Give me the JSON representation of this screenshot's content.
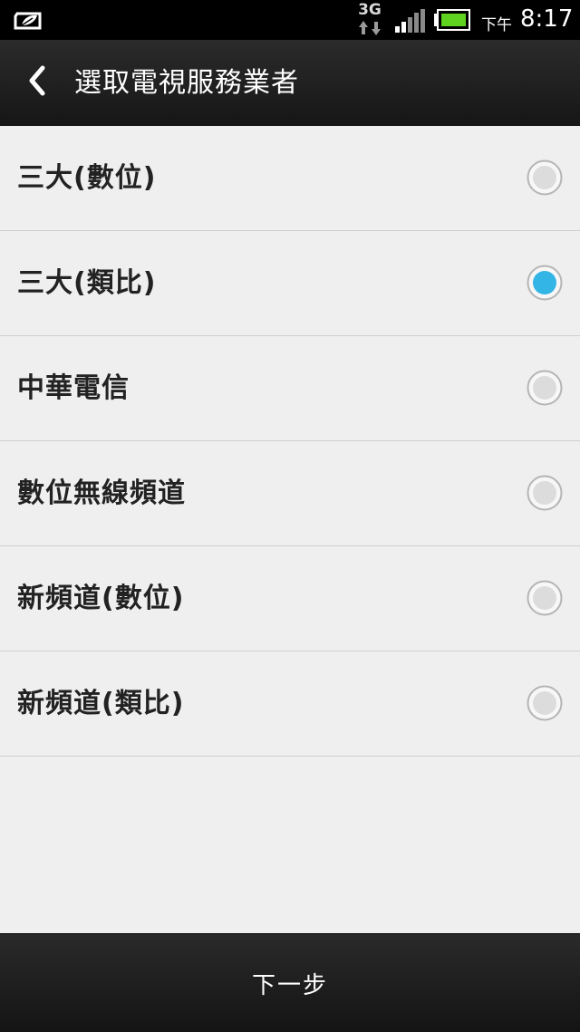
{
  "status_bar": {
    "network_type": "3G",
    "ampm": "下午",
    "time": "8:17",
    "icons": [
      "power-saver-leaf-icon",
      "data-arrows-icon",
      "signal-icon",
      "battery-icon"
    ]
  },
  "header": {
    "title": "選取電視服務業者",
    "back_icon": "chevron-left-icon"
  },
  "providers": [
    {
      "label": "三大(數位)",
      "selected": false
    },
    {
      "label": "三大(類比)",
      "selected": true
    },
    {
      "label": "中華電信",
      "selected": false
    },
    {
      "label": "數位無線頻道",
      "selected": false
    },
    {
      "label": "新頻道(數位)",
      "selected": false
    },
    {
      "label": "新頻道(類比)",
      "selected": false
    }
  ],
  "footer": {
    "next_label": "下一步"
  },
  "colors": {
    "accent": "#33b5e5",
    "background": "#efefef",
    "bar": "#1c1c1c",
    "battery": "#5fd21f"
  }
}
